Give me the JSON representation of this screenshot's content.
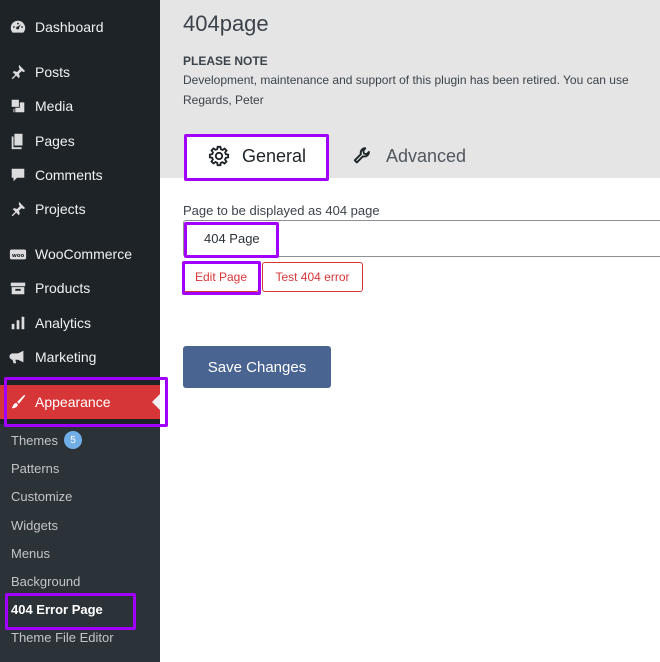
{
  "sidebar": {
    "items": [
      {
        "label": "Dashboard",
        "icon": "dashboard-icon"
      },
      {
        "label": "Posts",
        "icon": "pushpin-icon"
      },
      {
        "label": "Media",
        "icon": "media-icon"
      },
      {
        "label": "Pages",
        "icon": "pages-icon"
      },
      {
        "label": "Comments",
        "icon": "comment-icon"
      },
      {
        "label": "Projects",
        "icon": "pushpin-icon"
      },
      {
        "label": "WooCommerce",
        "icon": "woo-icon"
      },
      {
        "label": "Products",
        "icon": "archive-icon"
      },
      {
        "label": "Analytics",
        "icon": "bar-chart-icon"
      },
      {
        "label": "Marketing",
        "icon": "megaphone-icon"
      },
      {
        "label": "Appearance",
        "icon": "paintbrush-icon"
      }
    ],
    "submenu": [
      {
        "label": "Themes",
        "badge": "5"
      },
      {
        "label": "Patterns"
      },
      {
        "label": "Customize"
      },
      {
        "label": "Widgets"
      },
      {
        "label": "Menus"
      },
      {
        "label": "Background"
      },
      {
        "label": "404 Error Page"
      },
      {
        "label": "Theme File Editor"
      }
    ]
  },
  "main": {
    "title": "404page",
    "note_title": "PLEASE NOTE",
    "note_text": "Development, maintenance and support of this plugin has been retired. You can use",
    "note_sign": "Regards, Peter",
    "tabs": [
      {
        "label": "General",
        "icon": "gear-icon"
      },
      {
        "label": "Advanced",
        "icon": "wrench-icon"
      }
    ],
    "field_label": "Page to be displayed as 404 page",
    "select_value": "404 Page",
    "edit_button": "Edit Page",
    "test_button": "Test 404 error",
    "save_button": "Save Changes"
  },
  "colors": {
    "sidebar_bg": "#1d2327",
    "active_menu": "#d63638",
    "highlight": "#a100ff",
    "save_button": "#4a6491"
  }
}
